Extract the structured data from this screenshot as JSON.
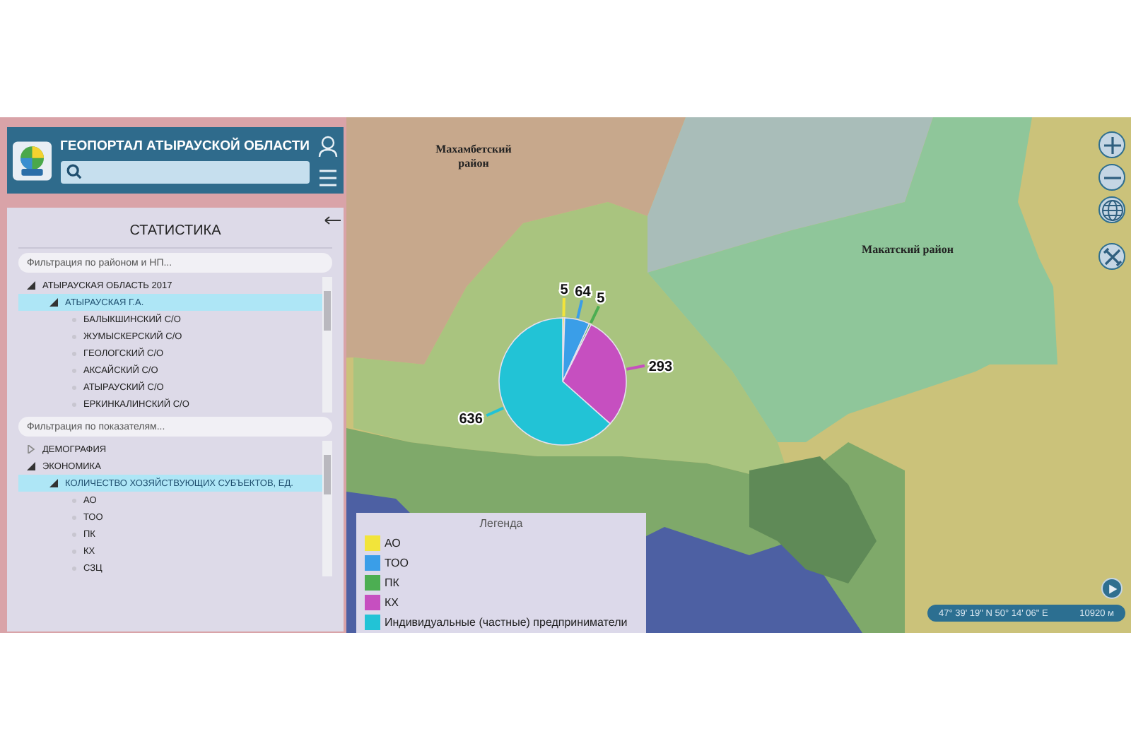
{
  "header": {
    "title": "ГЕОПОРТАЛ АТЫРАУСКОЙ ОБЛАСТИ"
  },
  "panel": {
    "title": "СТАТИСТИКА",
    "region_filter": {
      "placeholder": "Фильтрация по районом и НП..."
    },
    "regions": [
      {
        "label": "АТЫРАУСКАЯ ОБЛАСТЬ 2017",
        "expanded": true,
        "selected": false,
        "children": [
          {
            "label": "АТЫРАУСКАЯ Г.А.",
            "expanded": true,
            "selected": true,
            "children": [
              {
                "label": "БАЛЫКШИНСКИЙ С/О",
                "selected": false
              },
              {
                "label": "ЖУМЫСКЕРСКИЙ С/О",
                "selected": false
              },
              {
                "label": "ГЕОЛОГСКИЙ С/О",
                "selected": false
              },
              {
                "label": "АКСАЙСКИЙ С/О",
                "selected": false
              },
              {
                "label": "АТЫРАУСКИЙ С/О",
                "selected": false
              },
              {
                "label": "ЕРКИНКАЛИНСКИЙ С/О",
                "selected": false
              }
            ]
          }
        ]
      }
    ],
    "indicator_filter": {
      "placeholder": "Фильтрация по показателям..."
    },
    "indicators": [
      {
        "label": "ДЕМОГРАФИЯ",
        "expanded": false,
        "selected": false
      },
      {
        "label": "ЭКОНОМИКА",
        "expanded": true,
        "selected": false,
        "children": [
          {
            "label": "КОЛИЧЕСТВО ХОЗЯЙСТВУЮЩИХ СУБЪЕКТОВ, ЕД.",
            "expanded": true,
            "selected": true,
            "children": [
              {
                "label": "АО",
                "selected": false
              },
              {
                "label": "ТОО",
                "selected": false
              },
              {
                "label": "ПК",
                "selected": false
              },
              {
                "label": "КХ",
                "selected": false
              },
              {
                "label": "СЗЦ",
                "selected": false
              }
            ]
          }
        ]
      }
    ]
  },
  "map": {
    "labels": [
      {
        "text": "Махамбетский район"
      },
      {
        "text": "Макатский район"
      }
    ],
    "chart_data": {
      "type": "pie",
      "values": [
        5,
        64,
        5,
        293,
        636
      ],
      "data_labels": true
    },
    "legend": {
      "title": "Легенда",
      "items": [
        {
          "label": "АО",
          "color": "#f2e43a"
        },
        {
          "label": "ТОО",
          "color": "#3a9ee8"
        },
        {
          "label": "ПК",
          "color": "#4cae52"
        },
        {
          "label": "КХ",
          "color": "#c64fc0"
        },
        {
          "label": "Индивидуальные (частные) предприниматели",
          "color": "#22c3d6"
        }
      ]
    },
    "coordinates": "47° 39' 19\" N 50° 14' 06\" E",
    "scale": "10920 м"
  }
}
